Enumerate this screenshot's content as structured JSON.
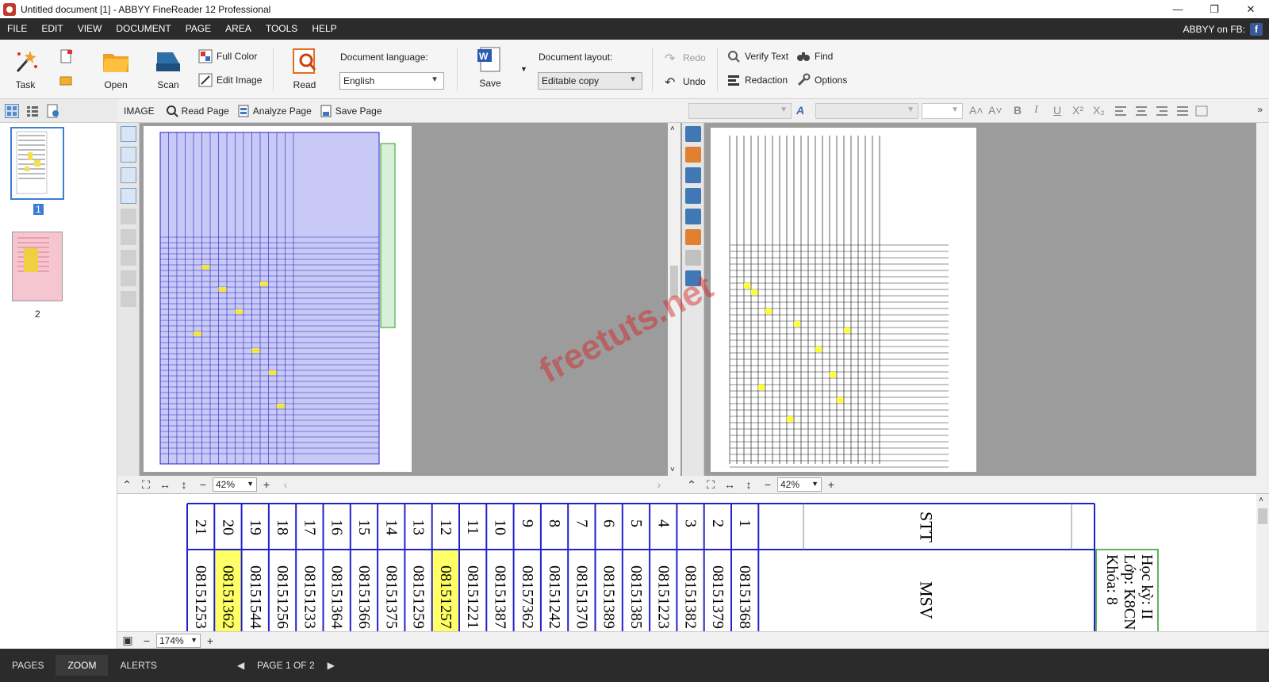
{
  "window": {
    "title": "Untitled document [1] - ABBYY FineReader 12 Professional",
    "controls": {
      "minimize": "—",
      "restore": "❐",
      "close": "✕"
    }
  },
  "menu": {
    "items": [
      "FILE",
      "EDIT",
      "VIEW",
      "DOCUMENT",
      "PAGE",
      "AREA",
      "TOOLS",
      "HELP"
    ],
    "right_text": "ABBYY on FB:",
    "fb_glyph": "f"
  },
  "ribbon": {
    "task": "Task",
    "open": "Open",
    "scan": "Scan",
    "full_color": "Full Color",
    "edit_image": "Edit Image",
    "read": "Read",
    "doc_language_label": "Document language:",
    "doc_language_value": "English",
    "save": "Save",
    "doc_layout_label": "Document layout:",
    "doc_layout_value": "Editable copy",
    "redo": "Redo",
    "undo": "Undo",
    "verify_text": "Verify Text",
    "redaction": "Redaction",
    "find": "Find",
    "options": "Options"
  },
  "image_toolbar": {
    "label": "IMAGE",
    "read_page": "Read Page",
    "analyze_page": "Analyze Page",
    "save_page": "Save Page"
  },
  "text_toolbar": {
    "format_buttons": [
      "A˄",
      "A˅",
      "B",
      "I",
      "U",
      "X²",
      "X₂"
    ]
  },
  "pages": {
    "items": [
      {
        "number": "1",
        "selected": true
      },
      {
        "number": "2",
        "selected": false
      }
    ]
  },
  "zoom": {
    "image_zoom": "42%",
    "text_zoom": "42%",
    "zoom_panel_zoom": "174%"
  },
  "zoom_panel": {
    "header_label": "STT",
    "msv_label": "MSV",
    "side_text_1": "Học kỳ: II",
    "side_text_2": "Lớp: K8CN",
    "side_text_3": "Khóa: 8",
    "columns": [
      {
        "stt": "21",
        "msv": "08151253",
        "highlight": false
      },
      {
        "stt": "20",
        "msv": "08151362",
        "highlight": true
      },
      {
        "stt": "19",
        "msv": "08151544",
        "highlight": false
      },
      {
        "stt": "18",
        "msv": "08151256",
        "highlight": false
      },
      {
        "stt": "17",
        "msv": "08151233",
        "highlight": false
      },
      {
        "stt": "16",
        "msv": "08151364",
        "highlight": false
      },
      {
        "stt": "15",
        "msv": "08151366",
        "highlight": false
      },
      {
        "stt": "14",
        "msv": "08151375",
        "highlight": false
      },
      {
        "stt": "13",
        "msv": "08151259",
        "highlight": false
      },
      {
        "stt": "12",
        "msv": "08151257",
        "highlight": true
      },
      {
        "stt": "11",
        "msv": "08151221",
        "highlight": false
      },
      {
        "stt": "10",
        "msv": "08151387",
        "highlight": false
      },
      {
        "stt": "9",
        "msv": "08157362",
        "highlight": false
      },
      {
        "stt": "8",
        "msv": "08151242",
        "highlight": false
      },
      {
        "stt": "7",
        "msv": "08151370",
        "highlight": false
      },
      {
        "stt": "6",
        "msv": "08151389",
        "highlight": false
      },
      {
        "stt": "5",
        "msv": "08151385",
        "highlight": false
      },
      {
        "stt": "4",
        "msv": "08151223",
        "highlight": false
      },
      {
        "stt": "3",
        "msv": "08151382",
        "highlight": false
      },
      {
        "stt": "2",
        "msv": "08151379",
        "highlight": false
      },
      {
        "stt": "1",
        "msv": "08151368",
        "highlight": false
      }
    ]
  },
  "status": {
    "pages_tab": "PAGES",
    "zoom_tab": "ZOOM",
    "alerts_tab": "ALERTS",
    "page_indicator": "PAGE 1 OF 2",
    "prev_glyph": "◀",
    "next_glyph": "▶"
  },
  "watermark": "freetuts.net",
  "colors": {
    "menubar": "#2b2b2b",
    "area_blue": "#2222cc",
    "area_fill": "#c9c9f5",
    "highlight_yellow": "#ffff66",
    "panel_gray": "#9c9c9c",
    "watermark": "#d62020"
  }
}
